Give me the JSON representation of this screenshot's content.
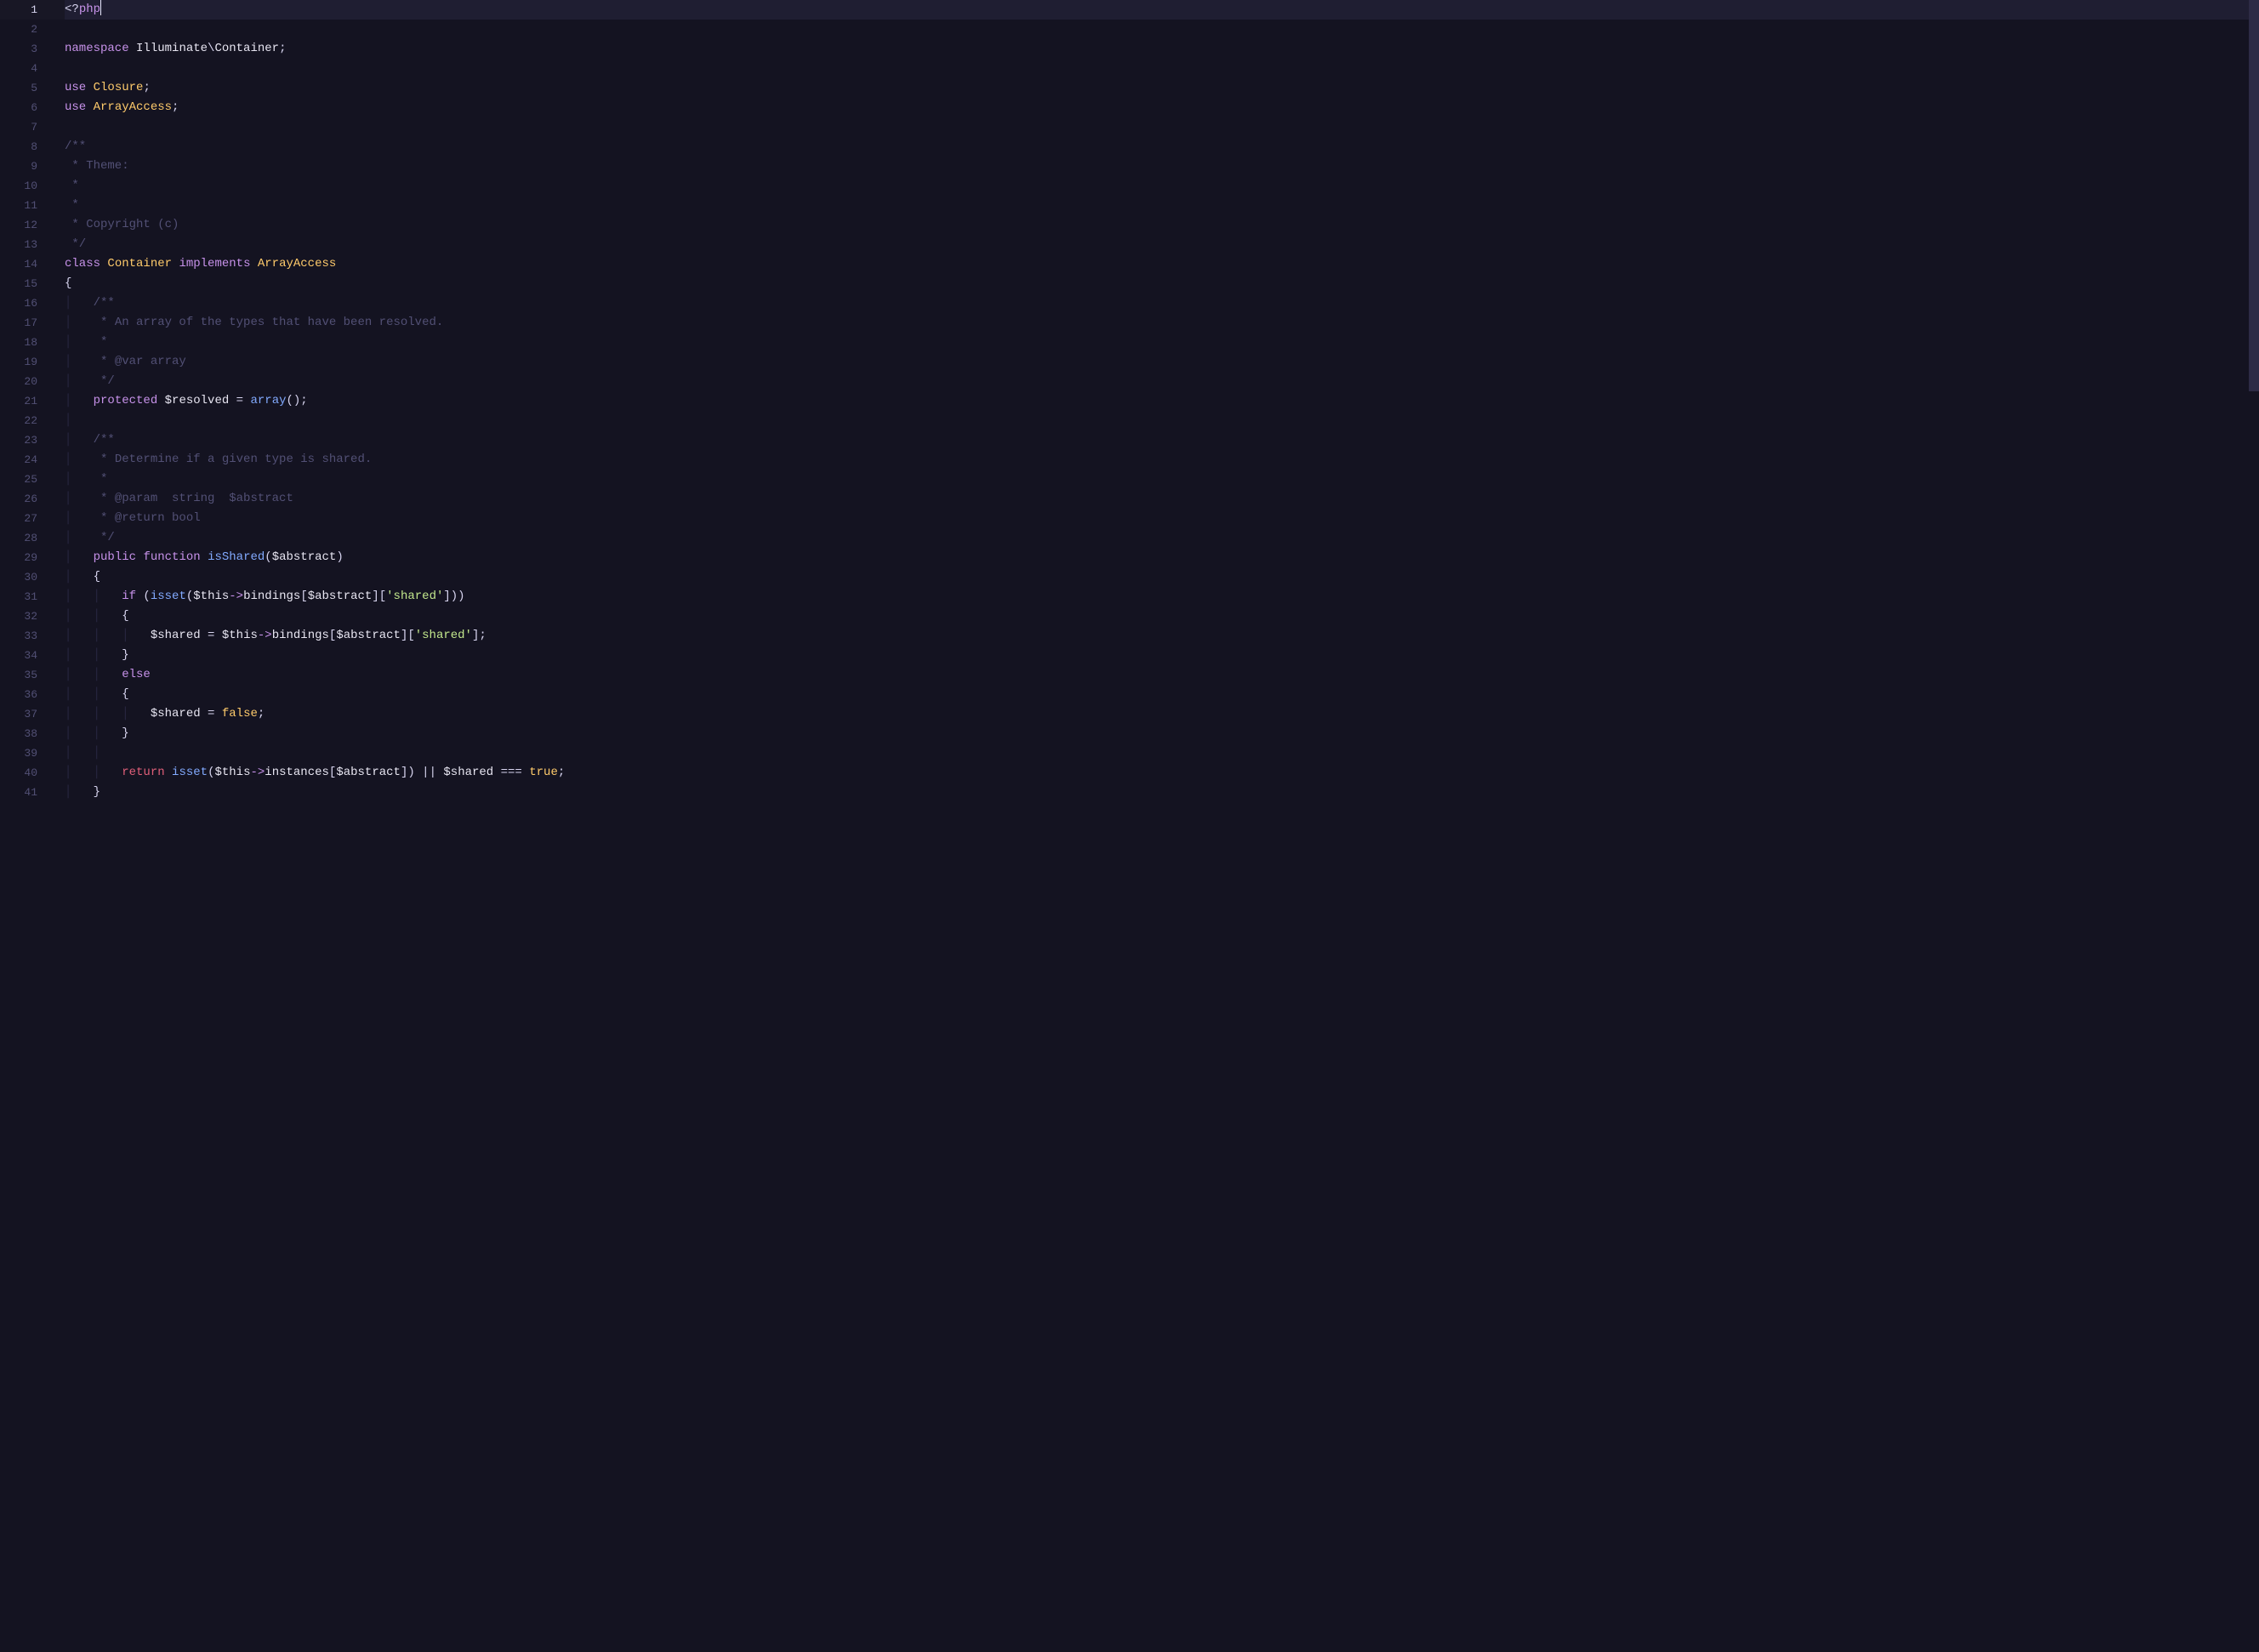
{
  "editor": {
    "lineCount": 41,
    "activeLine": 1,
    "lines": [
      {
        "n": 1,
        "tokens": [
          {
            "c": "tk-punct",
            "t": "<?"
          },
          {
            "c": "tk-keyword",
            "t": "php"
          },
          {
            "cursor": true
          }
        ]
      },
      {
        "n": 2,
        "tokens": []
      },
      {
        "n": 3,
        "tokens": [
          {
            "c": "tk-keyword",
            "t": "namespace"
          },
          {
            "c": "tk-punct",
            "t": " "
          },
          {
            "c": "tk-ns",
            "t": "Illuminate"
          },
          {
            "c": "tk-punct",
            "t": "\\"
          },
          {
            "c": "tk-ns",
            "t": "Container"
          },
          {
            "c": "tk-punct",
            "t": ";"
          }
        ]
      },
      {
        "n": 4,
        "tokens": []
      },
      {
        "n": 5,
        "tokens": [
          {
            "c": "tk-keyword",
            "t": "use"
          },
          {
            "c": "tk-punct",
            "t": " "
          },
          {
            "c": "tk-classname",
            "t": "Closure"
          },
          {
            "c": "tk-punct",
            "t": ";"
          }
        ]
      },
      {
        "n": 6,
        "tokens": [
          {
            "c": "tk-keyword",
            "t": "use"
          },
          {
            "c": "tk-punct",
            "t": " "
          },
          {
            "c": "tk-classname",
            "t": "ArrayAccess"
          },
          {
            "c": "tk-punct",
            "t": ";"
          }
        ]
      },
      {
        "n": 7,
        "tokens": []
      },
      {
        "n": 8,
        "tokens": [
          {
            "c": "tk-comment",
            "t": "/**"
          }
        ]
      },
      {
        "n": 9,
        "tokens": [
          {
            "c": "tk-comment",
            "t": " * Theme:"
          }
        ]
      },
      {
        "n": 10,
        "tokens": [
          {
            "c": "tk-comment",
            "t": " *"
          }
        ]
      },
      {
        "n": 11,
        "tokens": [
          {
            "c": "tk-comment",
            "t": " *"
          }
        ]
      },
      {
        "n": 12,
        "tokens": [
          {
            "c": "tk-comment",
            "t": " * Copyright (c)"
          }
        ]
      },
      {
        "n": 13,
        "tokens": [
          {
            "c": "tk-comment",
            "t": " */"
          }
        ]
      },
      {
        "n": 14,
        "tokens": [
          {
            "c": "tk-keyword",
            "t": "class"
          },
          {
            "c": "tk-punct",
            "t": " "
          },
          {
            "c": "tk-classname",
            "t": "Container"
          },
          {
            "c": "tk-punct",
            "t": " "
          },
          {
            "c": "tk-keyword",
            "t": "implements"
          },
          {
            "c": "tk-punct",
            "t": " "
          },
          {
            "c": "tk-classname",
            "t": "ArrayAccess"
          }
        ]
      },
      {
        "n": 15,
        "tokens": [
          {
            "c": "tk-punct",
            "t": "{"
          }
        ]
      },
      {
        "n": 16,
        "tokens": [
          {
            "c": "indent-guide",
            "t": "│   "
          },
          {
            "c": "tk-comment",
            "t": "/**"
          }
        ]
      },
      {
        "n": 17,
        "tokens": [
          {
            "c": "indent-guide",
            "t": "│   "
          },
          {
            "c": "tk-comment",
            "t": " * An array of the types that have been resolved."
          }
        ]
      },
      {
        "n": 18,
        "tokens": [
          {
            "c": "indent-guide",
            "t": "│   "
          },
          {
            "c": "tk-comment",
            "t": " *"
          }
        ]
      },
      {
        "n": 19,
        "tokens": [
          {
            "c": "indent-guide",
            "t": "│   "
          },
          {
            "c": "tk-comment",
            "t": " * @var array"
          }
        ]
      },
      {
        "n": 20,
        "tokens": [
          {
            "c": "indent-guide",
            "t": "│   "
          },
          {
            "c": "tk-comment",
            "t": " */"
          }
        ]
      },
      {
        "n": 21,
        "tokens": [
          {
            "c": "indent-guide",
            "t": "│   "
          },
          {
            "c": "tk-keyword",
            "t": "protected"
          },
          {
            "c": "tk-punct",
            "t": " "
          },
          {
            "c": "tk-var",
            "t": "$resolved"
          },
          {
            "c": "tk-punct",
            "t": " "
          },
          {
            "c": "tk-op",
            "t": "="
          },
          {
            "c": "tk-punct",
            "t": " "
          },
          {
            "c": "tk-func",
            "t": "array"
          },
          {
            "c": "tk-punct",
            "t": "();"
          }
        ]
      },
      {
        "n": 22,
        "tokens": [
          {
            "c": "indent-guide",
            "t": "│"
          }
        ]
      },
      {
        "n": 23,
        "tokens": [
          {
            "c": "indent-guide",
            "t": "│   "
          },
          {
            "c": "tk-comment",
            "t": "/**"
          }
        ]
      },
      {
        "n": 24,
        "tokens": [
          {
            "c": "indent-guide",
            "t": "│   "
          },
          {
            "c": "tk-comment",
            "t": " * Determine if a given type is shared."
          }
        ]
      },
      {
        "n": 25,
        "tokens": [
          {
            "c": "indent-guide",
            "t": "│   "
          },
          {
            "c": "tk-comment",
            "t": " *"
          }
        ]
      },
      {
        "n": 26,
        "tokens": [
          {
            "c": "indent-guide",
            "t": "│   "
          },
          {
            "c": "tk-comment",
            "t": " * @param  string  $abstract"
          }
        ]
      },
      {
        "n": 27,
        "tokens": [
          {
            "c": "indent-guide",
            "t": "│   "
          },
          {
            "c": "tk-comment",
            "t": " * @return bool"
          }
        ]
      },
      {
        "n": 28,
        "tokens": [
          {
            "c": "indent-guide",
            "t": "│   "
          },
          {
            "c": "tk-comment",
            "t": " */"
          }
        ]
      },
      {
        "n": 29,
        "tokens": [
          {
            "c": "indent-guide",
            "t": "│   "
          },
          {
            "c": "tk-keyword",
            "t": "public"
          },
          {
            "c": "tk-punct",
            "t": " "
          },
          {
            "c": "tk-keyword",
            "t": "function"
          },
          {
            "c": "tk-punct",
            "t": " "
          },
          {
            "c": "tk-func",
            "t": "isShared"
          },
          {
            "c": "tk-punct",
            "t": "("
          },
          {
            "c": "tk-var",
            "t": "$abstract"
          },
          {
            "c": "tk-punct",
            "t": ")"
          }
        ]
      },
      {
        "n": 30,
        "tokens": [
          {
            "c": "indent-guide",
            "t": "│   "
          },
          {
            "c": "tk-punct",
            "t": "{"
          }
        ]
      },
      {
        "n": 31,
        "tokens": [
          {
            "c": "indent-guide",
            "t": "│   │   "
          },
          {
            "c": "tk-keyword",
            "t": "if"
          },
          {
            "c": "tk-punct",
            "t": " ("
          },
          {
            "c": "tk-func",
            "t": "isset"
          },
          {
            "c": "tk-punct",
            "t": "("
          },
          {
            "c": "tk-var",
            "t": "$this"
          },
          {
            "c": "tk-oparrow",
            "t": "->"
          },
          {
            "c": "tk-var",
            "t": "bindings"
          },
          {
            "c": "tk-punct",
            "t": "["
          },
          {
            "c": "tk-var",
            "t": "$abstract"
          },
          {
            "c": "tk-punct",
            "t": "]["
          },
          {
            "c": "tk-string",
            "t": "'shared'"
          },
          {
            "c": "tk-punct",
            "t": "]))"
          }
        ]
      },
      {
        "n": 32,
        "tokens": [
          {
            "c": "indent-guide",
            "t": "│   │   "
          },
          {
            "c": "tk-punct",
            "t": "{"
          }
        ]
      },
      {
        "n": 33,
        "tokens": [
          {
            "c": "indent-guide",
            "t": "│   │   │   "
          },
          {
            "c": "tk-var",
            "t": "$shared"
          },
          {
            "c": "tk-punct",
            "t": " "
          },
          {
            "c": "tk-op",
            "t": "="
          },
          {
            "c": "tk-punct",
            "t": " "
          },
          {
            "c": "tk-var",
            "t": "$this"
          },
          {
            "c": "tk-oparrow",
            "t": "->"
          },
          {
            "c": "tk-var",
            "t": "bindings"
          },
          {
            "c": "tk-punct",
            "t": "["
          },
          {
            "c": "tk-var",
            "t": "$abstract"
          },
          {
            "c": "tk-punct",
            "t": "]["
          },
          {
            "c": "tk-string",
            "t": "'shared'"
          },
          {
            "c": "tk-punct",
            "t": "];"
          }
        ]
      },
      {
        "n": 34,
        "tokens": [
          {
            "c": "indent-guide",
            "t": "│   │   "
          },
          {
            "c": "tk-punct",
            "t": "}"
          }
        ]
      },
      {
        "n": 35,
        "tokens": [
          {
            "c": "indent-guide",
            "t": "│   │   "
          },
          {
            "c": "tk-keyword",
            "t": "else"
          }
        ]
      },
      {
        "n": 36,
        "tokens": [
          {
            "c": "indent-guide",
            "t": "│   │   "
          },
          {
            "c": "tk-punct",
            "t": "{"
          }
        ]
      },
      {
        "n": 37,
        "tokens": [
          {
            "c": "indent-guide",
            "t": "│   │   │   "
          },
          {
            "c": "tk-var",
            "t": "$shared"
          },
          {
            "c": "tk-punct",
            "t": " "
          },
          {
            "c": "tk-op",
            "t": "="
          },
          {
            "c": "tk-punct",
            "t": " "
          },
          {
            "c": "tk-bool",
            "t": "false"
          },
          {
            "c": "tk-punct",
            "t": ";"
          }
        ]
      },
      {
        "n": 38,
        "tokens": [
          {
            "c": "indent-guide",
            "t": "│   │   "
          },
          {
            "c": "tk-punct",
            "t": "}"
          }
        ]
      },
      {
        "n": 39,
        "tokens": [
          {
            "c": "indent-guide",
            "t": "│   │"
          }
        ]
      },
      {
        "n": 40,
        "tokens": [
          {
            "c": "indent-guide",
            "t": "│   │   "
          },
          {
            "c": "tk-keyword-red",
            "t": "return"
          },
          {
            "c": "tk-punct",
            "t": " "
          },
          {
            "c": "tk-func",
            "t": "isset"
          },
          {
            "c": "tk-punct",
            "t": "("
          },
          {
            "c": "tk-var",
            "t": "$this"
          },
          {
            "c": "tk-oparrow",
            "t": "->"
          },
          {
            "c": "tk-var",
            "t": "instances"
          },
          {
            "c": "tk-punct",
            "t": "["
          },
          {
            "c": "tk-var",
            "t": "$abstract"
          },
          {
            "c": "tk-punct",
            "t": "]) "
          },
          {
            "c": "tk-op",
            "t": "||"
          },
          {
            "c": "tk-punct",
            "t": " "
          },
          {
            "c": "tk-var",
            "t": "$shared"
          },
          {
            "c": "tk-punct",
            "t": " "
          },
          {
            "c": "tk-op",
            "t": "==="
          },
          {
            "c": "tk-punct",
            "t": " "
          },
          {
            "c": "tk-bool",
            "t": "true"
          },
          {
            "c": "tk-punct",
            "t": ";"
          }
        ]
      },
      {
        "n": 41,
        "tokens": [
          {
            "c": "indent-guide",
            "t": "│   "
          },
          {
            "c": "tk-punct",
            "t": "}"
          }
        ]
      }
    ]
  }
}
